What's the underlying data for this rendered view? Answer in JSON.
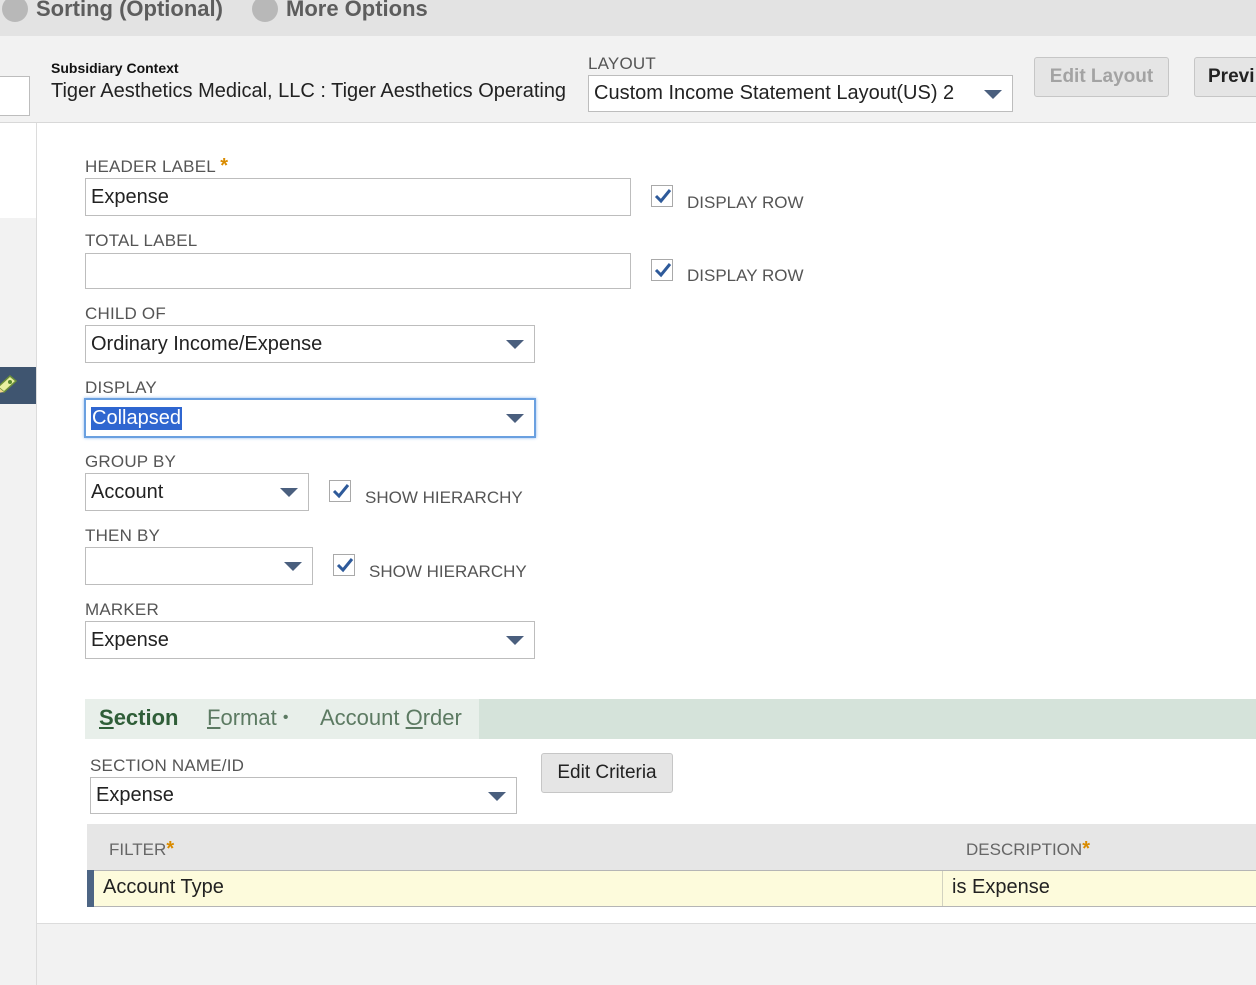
{
  "top_tabs": [
    {
      "label": "Sorting (Optional)"
    },
    {
      "label": "More Options"
    }
  ],
  "header": {
    "subsidiary_label": "Subsidiary Context",
    "subsidiary_value": "Tiger Aesthetics Medical, LLC : Tiger Aesthetics Operating",
    "layout_label": "LAYOUT",
    "layout_value": "Custom Income Statement Layout(US) 2",
    "edit_layout_button": "Edit Layout",
    "preview_button": "Previ"
  },
  "form": {
    "header_label": {
      "label": "HEADER LABEL",
      "required": "*",
      "value": "Expense",
      "display_row_label": "DISPLAY ROW",
      "display_row_checked": true
    },
    "total_label": {
      "label": "TOTAL LABEL",
      "value": "",
      "display_row_label": "DISPLAY ROW",
      "display_row_checked": true
    },
    "child_of": {
      "label": "CHILD OF",
      "value": "Ordinary Income/Expense"
    },
    "display": {
      "label": "DISPLAY",
      "value": "Collapsed"
    },
    "group_by": {
      "label": "GROUP BY",
      "value": "Account",
      "show_hierarchy_label": "SHOW HIERARCHY",
      "show_hierarchy_checked": true
    },
    "then_by": {
      "label": "THEN BY",
      "value": "",
      "show_hierarchy_label": "SHOW HIERARCHY",
      "show_hierarchy_checked": true
    },
    "marker": {
      "label": "MARKER",
      "value": "Expense"
    }
  },
  "subtabs": {
    "section": {
      "first": "S",
      "rest": "ection"
    },
    "format": {
      "first": "F",
      "rest": "ormat",
      "dot": "•"
    },
    "account_order": {
      "before": "Account ",
      "underlined": "O",
      "after": "rder"
    }
  },
  "section": {
    "name_label": "SECTION NAME/ID",
    "name_value": "Expense",
    "edit_criteria_button": "Edit Criteria"
  },
  "table": {
    "columns": [
      "FILTER",
      "DESCRIPTION"
    ],
    "required": "*",
    "rows": [
      {
        "filter": "Account Type",
        "description": "is Expense"
      }
    ]
  },
  "colors": {
    "accent_dark": "#3f5570",
    "required": "#d98b00",
    "subtab_bg": "#d5e3da",
    "row_highlight": "#fdfbdc",
    "selection": "#2f66d0"
  }
}
